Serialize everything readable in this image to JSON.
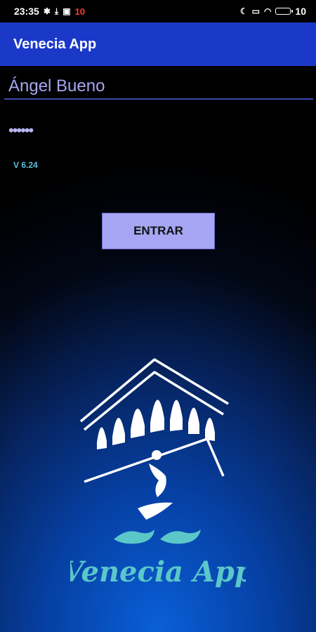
{
  "status_bar": {
    "time": "23:35",
    "notification_count": "10",
    "battery_level": "10"
  },
  "app_bar": {
    "title": "Venecia App"
  },
  "login": {
    "username_value": "Ángel Bueno",
    "password_masked": "••••••",
    "version": "V 6.24",
    "enter_label": "ENTRAR"
  },
  "logo": {
    "text": "Venecia App",
    "text_color": "#5bc7c9",
    "line_color": "#ffffff"
  },
  "colors": {
    "app_bar": "#1b39c9",
    "button": "#a6a6f4",
    "version_text": "#5bc0de"
  }
}
